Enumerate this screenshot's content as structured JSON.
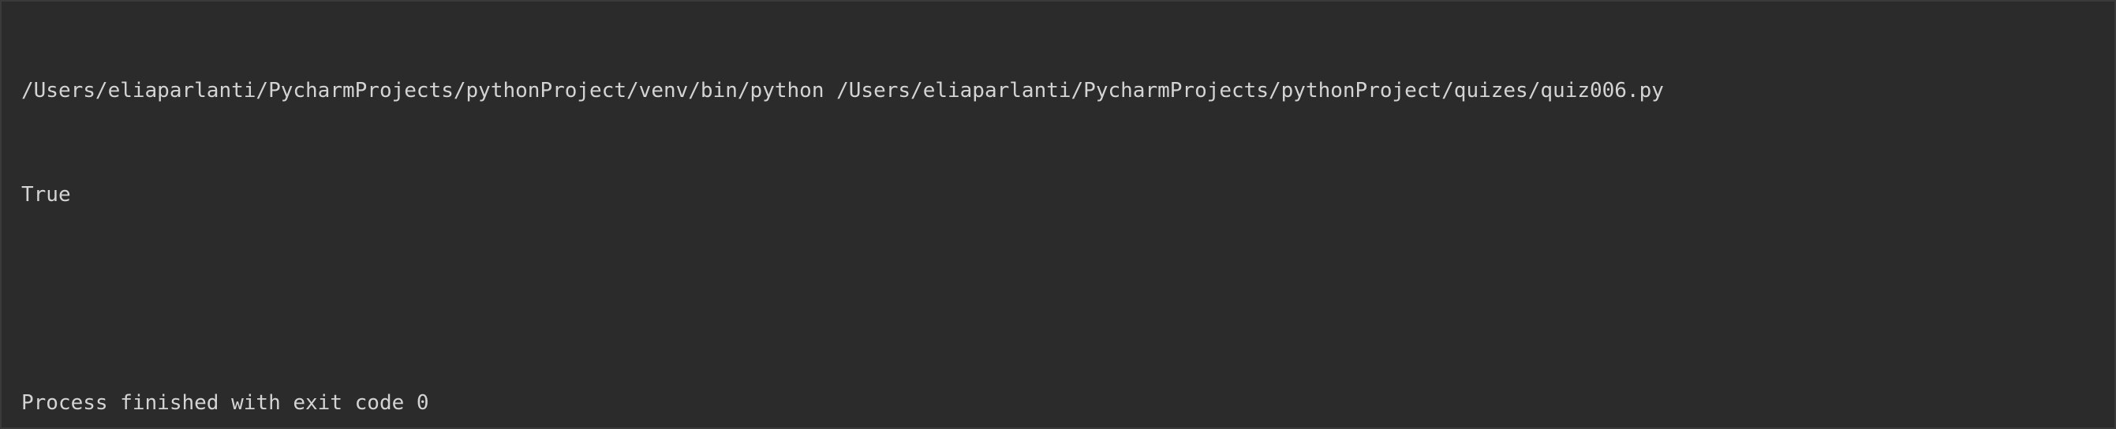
{
  "console": {
    "command": "/Users/eliaparlanti/PycharmProjects/pythonProject/venv/bin/python /Users/eliaparlanti/PycharmProjects/pythonProject/quizes/quiz006.py",
    "output": "True",
    "exit_message": "Process finished with exit code 0"
  },
  "colors": {
    "background": "#2b2b2b",
    "text": "#d4d4d4"
  }
}
